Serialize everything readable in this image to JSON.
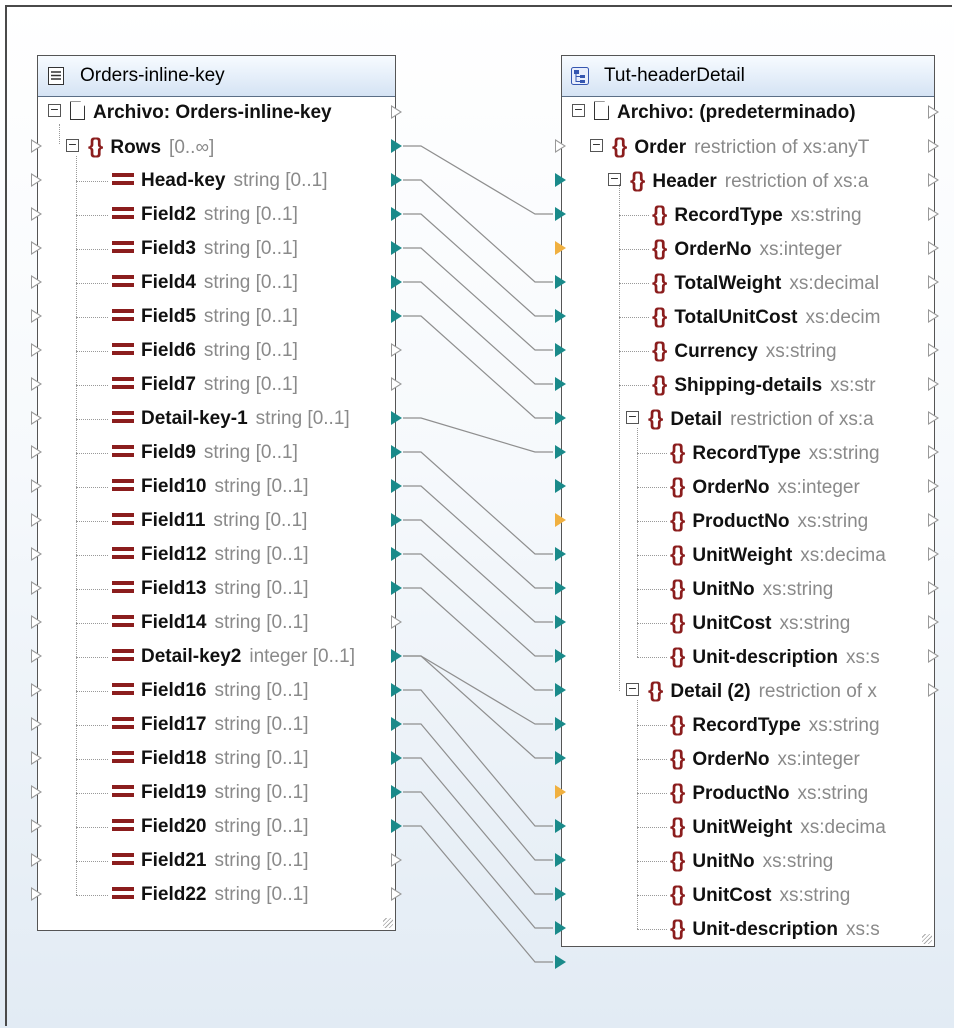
{
  "source": {
    "title": "Orders-inline-key",
    "title_icon": "text-file-icon",
    "file_node": {
      "label": "Archivo: Orders-inline-key"
    },
    "rows_node": {
      "name": "Rows",
      "type": "[0..∞]"
    },
    "fields": [
      {
        "name": "Head-key",
        "type": "string [0..1]"
      },
      {
        "name": "Field2",
        "type": "string [0..1]"
      },
      {
        "name": "Field3",
        "type": "string [0..1]"
      },
      {
        "name": "Field4",
        "type": "string [0..1]"
      },
      {
        "name": "Field5",
        "type": "string [0..1]"
      },
      {
        "name": "Field6",
        "type": "string [0..1]"
      },
      {
        "name": "Field7",
        "type": "string [0..1]"
      },
      {
        "name": "Detail-key-1",
        "type": "string [0..1]"
      },
      {
        "name": "Field9",
        "type": "string [0..1]"
      },
      {
        "name": "Field10",
        "type": "string [0..1]"
      },
      {
        "name": "Field11",
        "type": "string [0..1]"
      },
      {
        "name": "Field12",
        "type": "string [0..1]"
      },
      {
        "name": "Field13",
        "type": "string [0..1]"
      },
      {
        "name": "Field14",
        "type": "string [0..1]"
      },
      {
        "name": "Detail-key2",
        "type": "integer [0..1]"
      },
      {
        "name": "Field16",
        "type": "string [0..1]"
      },
      {
        "name": "Field17",
        "type": "string [0..1]"
      },
      {
        "name": "Field18",
        "type": "string [0..1]"
      },
      {
        "name": "Field19",
        "type": "string [0..1]"
      },
      {
        "name": "Field20",
        "type": "string [0..1]"
      },
      {
        "name": "Field21",
        "type": "string [0..1]"
      },
      {
        "name": "Field22",
        "type": "string [0..1]"
      }
    ]
  },
  "target": {
    "title": "Tut-headerDetail",
    "title_icon": "xml-schema-icon",
    "file_node": {
      "label": "Archivo: (predeterminado)"
    },
    "order_node": {
      "name": "Order",
      "type": "restriction of xs:anyT"
    },
    "header_node": {
      "name": "Header",
      "type": "restriction of xs:a"
    },
    "header_children": [
      {
        "name": "RecordType",
        "type": "xs:string"
      },
      {
        "name": "OrderNo",
        "type": "xs:integer"
      },
      {
        "name": "TotalWeight",
        "type": "xs:decimal"
      },
      {
        "name": "TotalUnitCost",
        "type": "xs:decim"
      },
      {
        "name": "Currency",
        "type": "xs:string"
      },
      {
        "name": "Shipping-details",
        "type": "xs:str"
      }
    ],
    "detail_node": {
      "name": "Detail",
      "type": "restriction of xs:a"
    },
    "detail_children": [
      {
        "name": "RecordType",
        "type": "xs:string"
      },
      {
        "name": "OrderNo",
        "type": "xs:integer"
      },
      {
        "name": "ProductNo",
        "type": "xs:string"
      },
      {
        "name": "UnitWeight",
        "type": "xs:decima"
      },
      {
        "name": "UnitNo",
        "type": "xs:string"
      },
      {
        "name": "UnitCost",
        "type": "xs:string"
      },
      {
        "name": "Unit-description",
        "type": "xs:s"
      }
    ],
    "detail2_node": {
      "name": "Detail (2)",
      "type": "restriction of x"
    },
    "detail2_children": [
      {
        "name": "RecordType",
        "type": "xs:string"
      },
      {
        "name": "OrderNo",
        "type": "xs:integer"
      },
      {
        "name": "ProductNo",
        "type": "xs:string"
      },
      {
        "name": "UnitWeight",
        "type": "xs:decima"
      },
      {
        "name": "UnitNo",
        "type": "xs:string"
      },
      {
        "name": "UnitCost",
        "type": "xs:string"
      },
      {
        "name": "Unit-description",
        "type": "xs:s"
      }
    ]
  },
  "colors": {
    "connected_port": "#1a8a8a",
    "default_port": "#f0b040",
    "element_bracket": "#8b1d1d",
    "type_text": "#8a8a8a"
  }
}
